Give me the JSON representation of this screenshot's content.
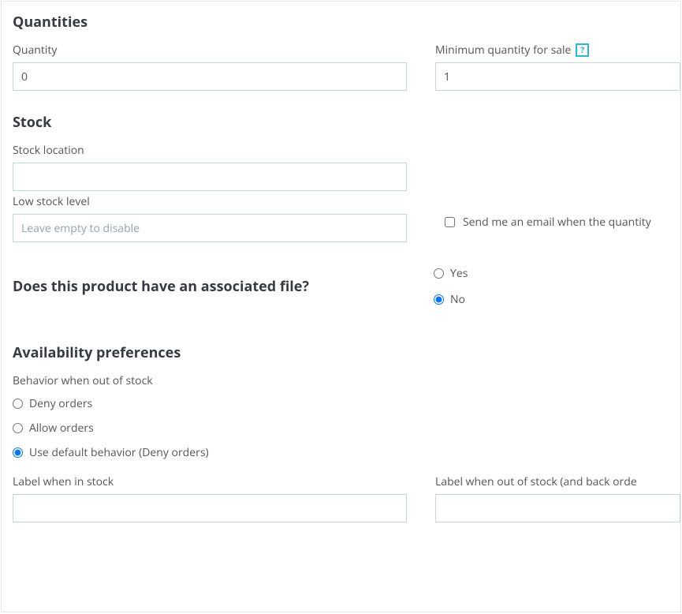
{
  "quantities": {
    "heading": "Quantities",
    "quantity_label": "Quantity",
    "quantity_value": "0",
    "min_qty_label": "Minimum quantity for sale",
    "min_qty_value": "1",
    "help_glyph": "?"
  },
  "stock": {
    "heading": "Stock",
    "location_label": "Stock location",
    "location_value": "",
    "low_level_label": "Low stock level",
    "low_level_value": "",
    "low_level_placeholder": "Leave empty to disable",
    "email_alert_label": "Send me an email when the quantity"
  },
  "associated": {
    "heading": "Does this product have an associated file?",
    "yes_label": "Yes",
    "no_label": "No",
    "selected": "no"
  },
  "availability": {
    "heading": "Availability preferences",
    "behavior_label": "Behavior when out of stock",
    "options": {
      "deny": "Deny orders",
      "allow": "Allow orders",
      "default": "Use default behavior (Deny orders)"
    },
    "selected": "default",
    "in_stock_label": "Label when in stock",
    "in_stock_value": "",
    "out_stock_label": "Label when out of stock (and back orde",
    "out_stock_value": ""
  }
}
